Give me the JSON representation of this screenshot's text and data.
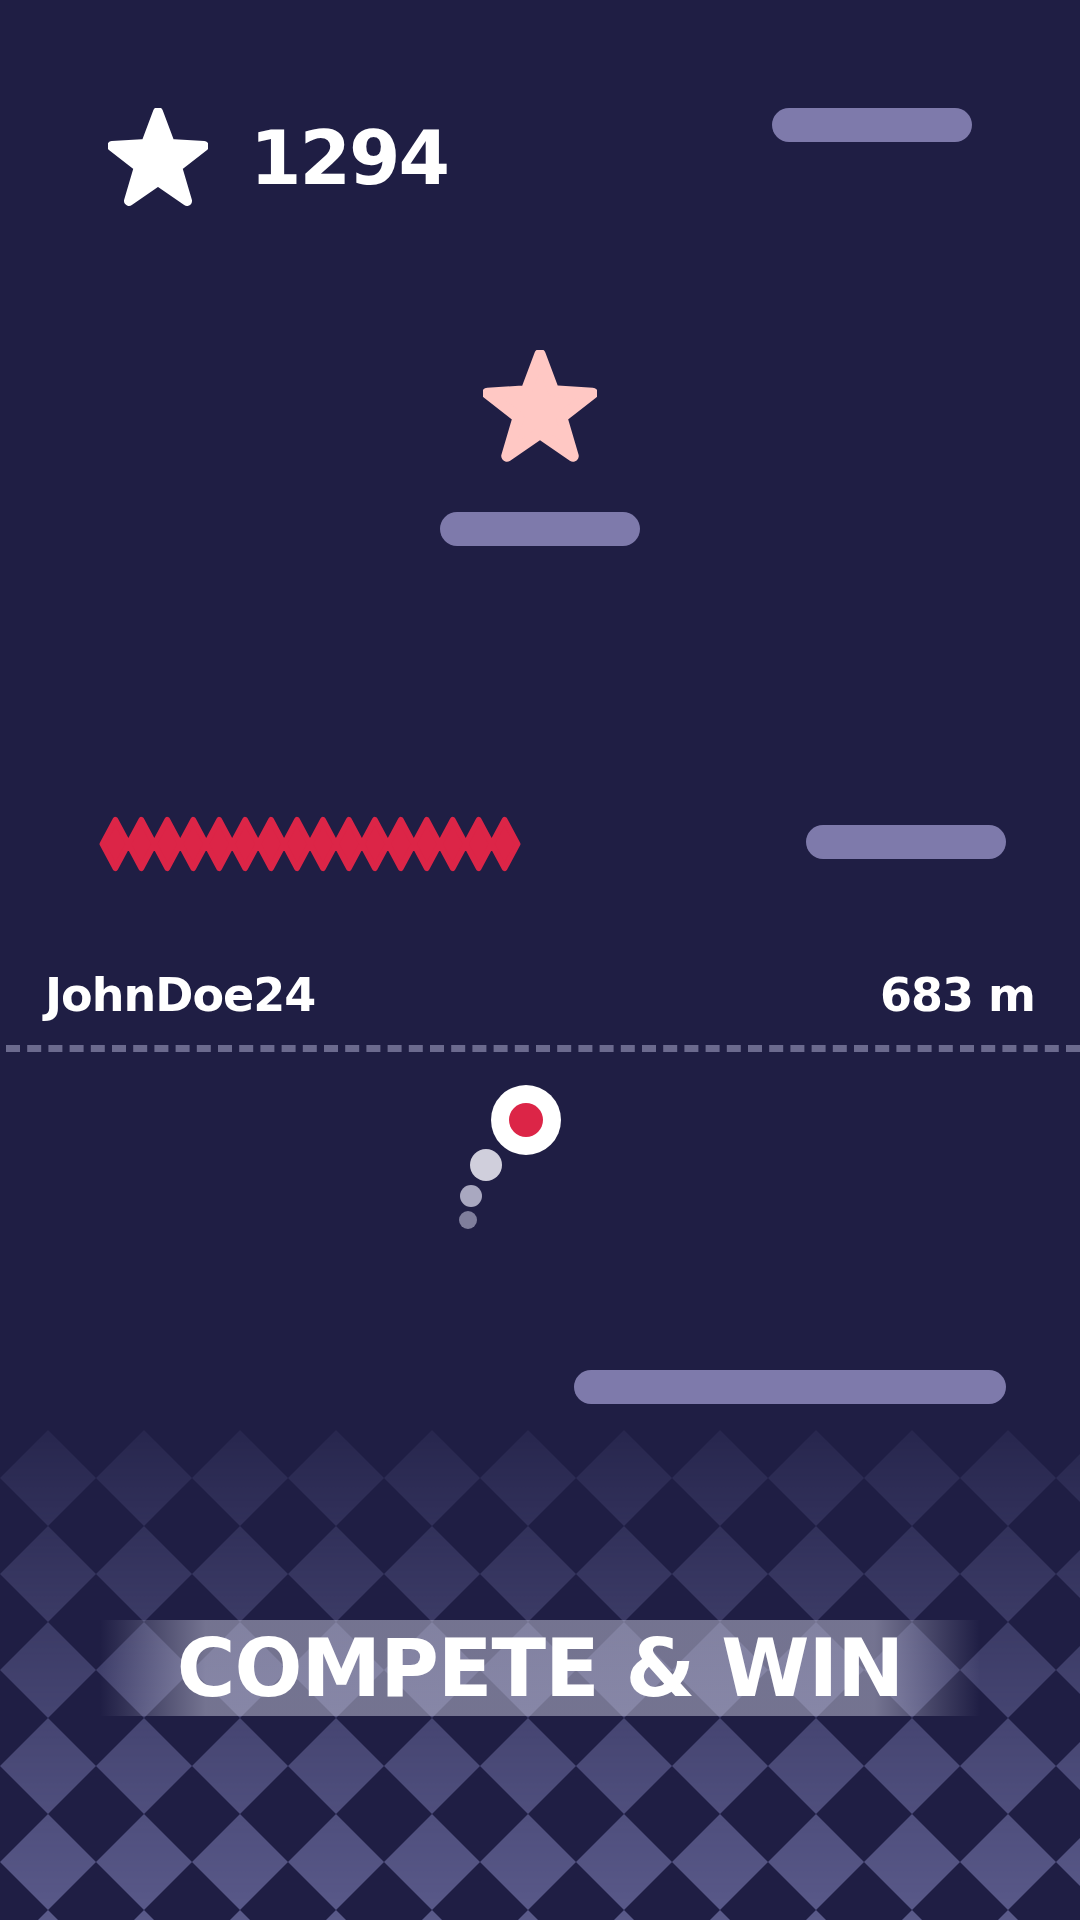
{
  "score": "1294",
  "player": {
    "name": "JohnDoe24",
    "distance": "683 m"
  },
  "banner": "COMPETE & WIN"
}
